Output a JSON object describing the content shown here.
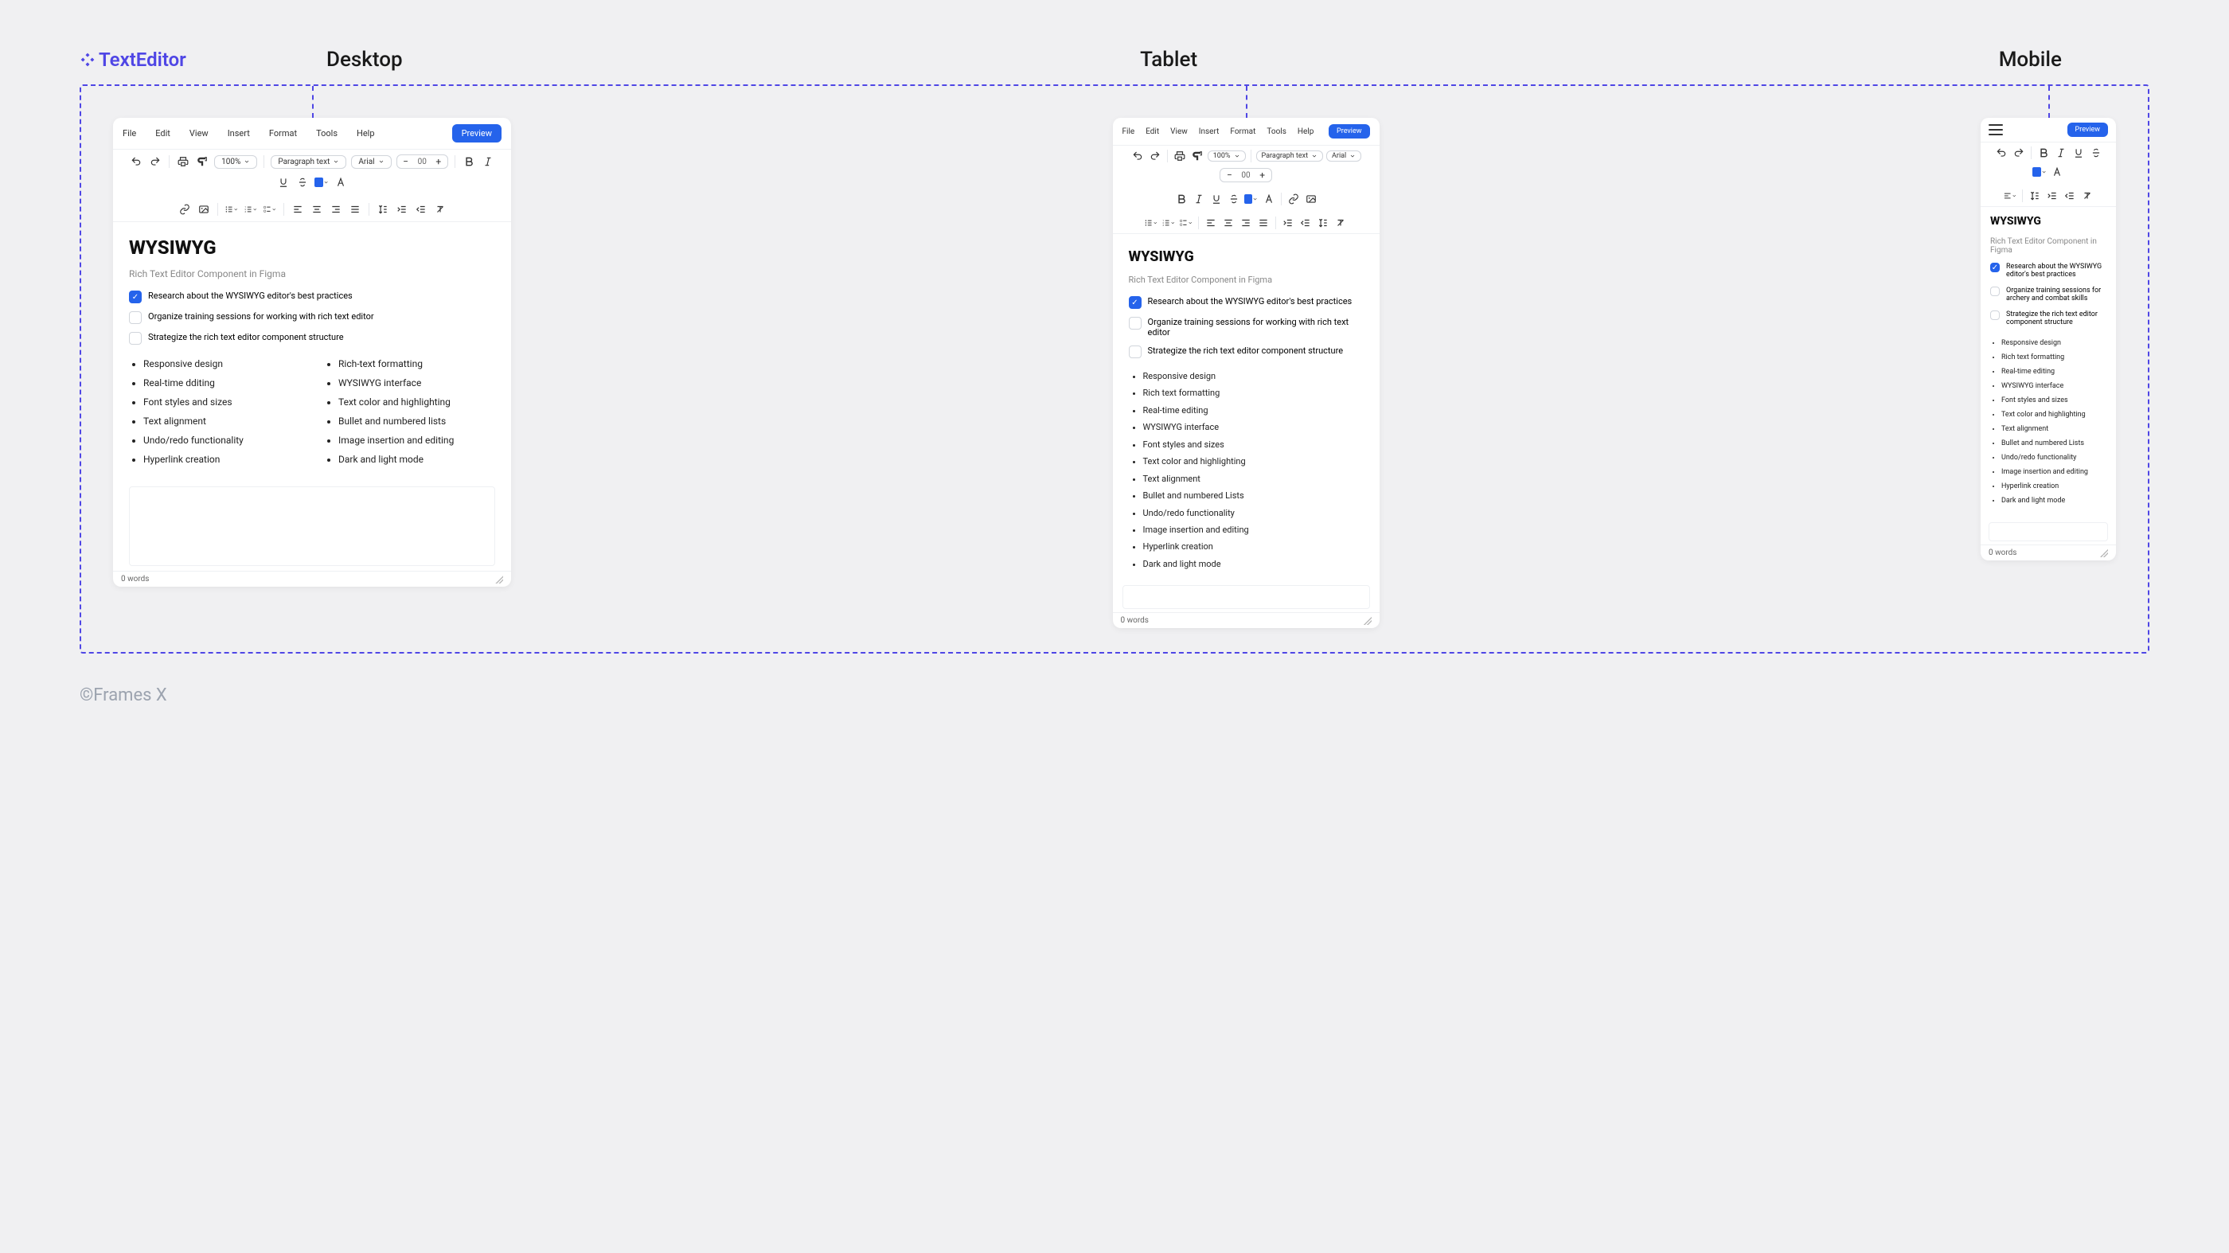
{
  "brand": {
    "name": "TextEditor"
  },
  "viewports": {
    "desktop": "Desktop",
    "tablet": "Tablet",
    "mobile": "Mobile"
  },
  "menu": {
    "file": "File",
    "edit": "Edit",
    "view": "View",
    "insert": "Insert",
    "format": "Format",
    "tools": "Tools",
    "help": "Help"
  },
  "actions": {
    "preview": "Preview"
  },
  "toolbar": {
    "zoom": "100%",
    "para": "Paragraph text",
    "font": "Arial",
    "fontsize": "00",
    "color": "#2563eb"
  },
  "document": {
    "heading": "WYSIWYG",
    "subtitle": "Rich Text Editor Component in Figma"
  },
  "checks_desktop": {
    "c1": "Research about the WYSIWYG editor's best practices",
    "c2": "Organize training sessions for working with rich text editor",
    "c3": "Strategize the rich text editor component structure"
  },
  "checks_tablet": {
    "c1": "Research about the WYSIWYG editor's best practices",
    "c2": "Organize training sessions for working with rich text editor",
    "c3": "Strategize the rich text editor component structure"
  },
  "checks_mobile": {
    "c1": "Research about the WYSIWYG editor's best practices",
    "c2": "Organize training sessions for archery and combat skills",
    "c3": "Strategize the rich text editor component structure"
  },
  "bullets_desktop": {
    "b1": "Responsive design",
    "b2": "Real-time dditing",
    "b3": "Font styles and sizes",
    "b4": "Text alignment",
    "b5": "Undo/redo functionality",
    "b6": "Hyperlink creation",
    "b7": "Rich-text formatting",
    "b8": "WYSIWYG interface",
    "b9": "Text color and highlighting",
    "b10": "Bullet and numbered lists",
    "b11": "Image insertion and editing",
    "b12": "Dark and light mode"
  },
  "bullets_tablet": {
    "b1": "Responsive design",
    "b2": "Rich text formatting",
    "b3": "Real-time editing",
    "b4": "WYSIWYG interface",
    "b5": "Font styles and sizes",
    "b6": "Text color and highlighting",
    "b7": "Text alignment",
    "b8": "Bullet and numbered Lists",
    "b9": "Undo/redo functionality",
    "b10": "Image insertion and editing",
    "b11": "Hyperlink creation",
    "b12": "Dark and light mode"
  },
  "bullets_mobile": {
    "b1": "Responsive design",
    "b2": "Rich text formatting",
    "b3": "Real-time editing",
    "b4": "WYSIWYG interface",
    "b5": "Font styles and sizes",
    "b6": "Text color and highlighting",
    "b7": "Text alignment",
    "b8": "Bullet and numbered Lists",
    "b9": "Undo/redo functionality",
    "b10": "Image insertion and editing",
    "b11": "Hyperlink creation",
    "b12": "Dark and light mode"
  },
  "status": {
    "words": "0 words"
  },
  "footer": "©Frames X"
}
